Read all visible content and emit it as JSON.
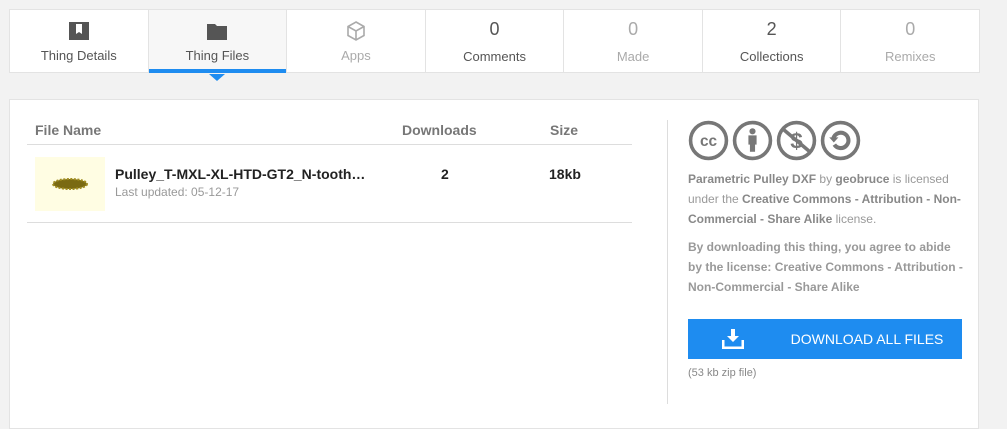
{
  "tabs": [
    {
      "label": "Thing Details",
      "icon": "book-icon"
    },
    {
      "label": "Thing Files",
      "icon": "folder-icon",
      "active": true
    },
    {
      "label": "Apps",
      "icon": "cube-icon"
    },
    {
      "label": "Comments",
      "count": "0"
    },
    {
      "label": "Made",
      "count": "0"
    },
    {
      "label": "Collections",
      "count": "2"
    },
    {
      "label": "Remixes",
      "count": "0"
    }
  ],
  "table": {
    "headers": [
      "File Name",
      "Downloads",
      "Size"
    ],
    "rows": [
      {
        "name": "Pulley_T-MXL-XL-HTD-GT2_N-tooth…",
        "updated": "Last updated: 05-12-17",
        "downloads": "2",
        "size": "18kb"
      }
    ]
  },
  "license": {
    "thing": "Parametric Pulley DXF",
    "by": " by ",
    "author": "geobruce",
    "is": " is licensed under the ",
    "name": "Creative Commons - Attribution - Non-Commercial - Share Alike",
    "suffix": " license.",
    "agree": "By downloading this thing, you agree to abide by the license: Creative Commons - Attribution - Non-Commercial - Share Alike"
  },
  "download": {
    "label": "DOWNLOAD ALL FILES",
    "note": "(53 kb zip file)"
  },
  "colors": {
    "accent": "#1e8cf0"
  }
}
